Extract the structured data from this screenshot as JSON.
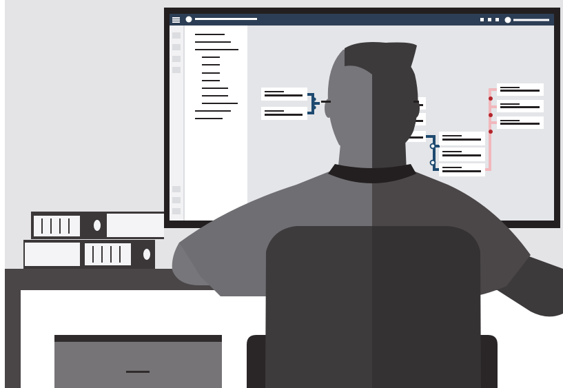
{
  "palette": {
    "wall": "#e4e4e6",
    "desk_top": "#4a4547",
    "desk_dark": "#2f2b2c",
    "monitor_frame": "#231f20",
    "screen_bg": "#e4e5e8",
    "titlebar": "#2c3e55",
    "sidebar_bg": "#ffffff",
    "rail_bg": "#f2f2f4",
    "bar_dark": "#231f20",
    "bar_blue": "#1e4a70",
    "bar_pink": "#f1b8bc",
    "dot_red": "#b3252c",
    "skin_light": "#77767a",
    "skin_dark": "#3d3a3c",
    "shirt_light": "#6f6e72",
    "shirt_dark": "#4b4749",
    "chair": "#3e3b3d",
    "chair_dark": "#2a2627",
    "binder_dark": "#3b3738",
    "binder_white": "#f4f4f6",
    "drawer": "#767477"
  },
  "icons": {
    "menu": "hamburger-icon",
    "app": "app-dot-icon",
    "window_controls": [
      "window-square-icon",
      "window-square-icon",
      "window-square-icon"
    ],
    "account": "account-dot-icon"
  }
}
